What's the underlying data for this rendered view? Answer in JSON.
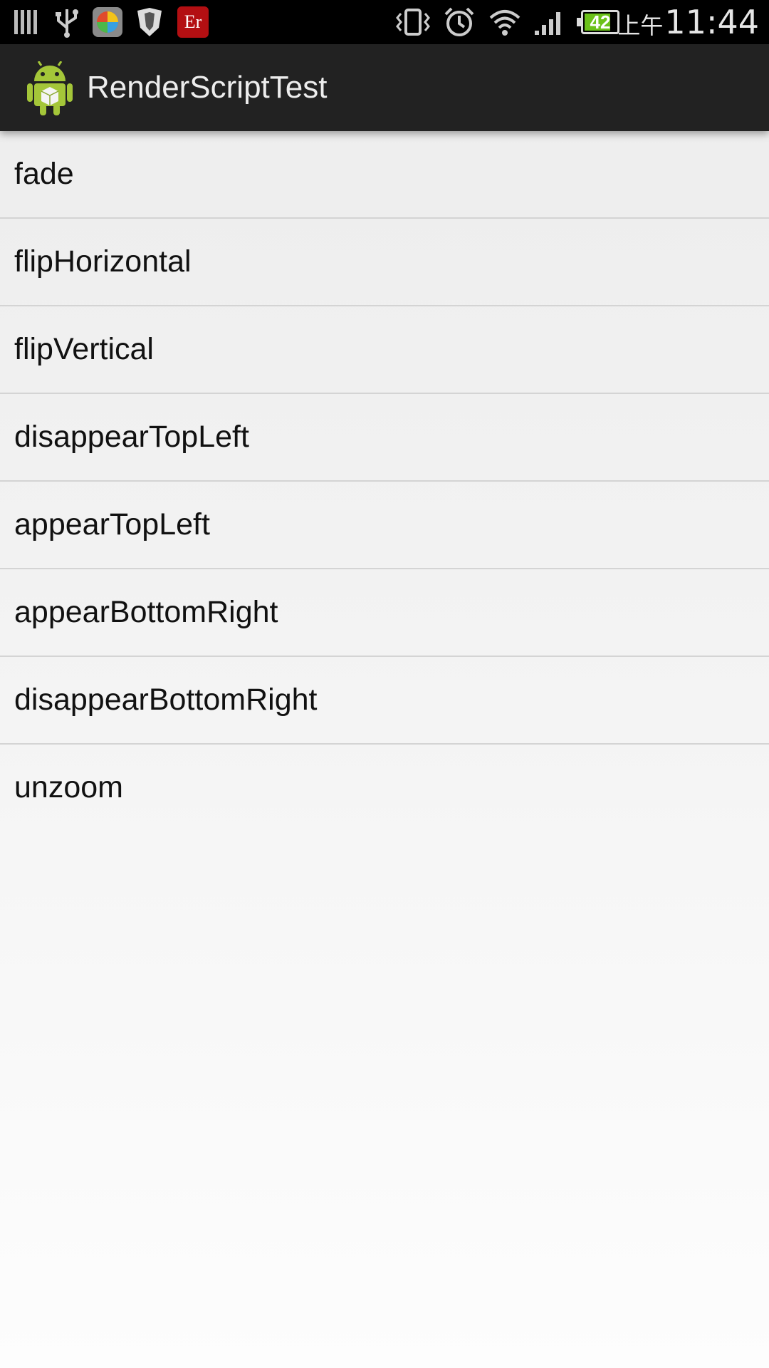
{
  "status_bar": {
    "icons": [
      "signal-bars-notification-icon",
      "usb-icon",
      "color-ball-app-icon",
      "shield-icon",
      "er-app-icon",
      "vibrate-icon",
      "alarm-icon",
      "wifi-icon",
      "cell-signal-icon",
      "battery-icon"
    ],
    "er_label": "Er",
    "battery_level": "42",
    "time_prefix": "上午",
    "time": "11:44"
  },
  "action_bar": {
    "title": "RenderScriptTest",
    "background": "#222222"
  },
  "list": {
    "items": [
      {
        "label": "fade"
      },
      {
        "label": "flipHorizontal"
      },
      {
        "label": "flipVertical"
      },
      {
        "label": "disappearTopLeft"
      },
      {
        "label": "appearTopLeft"
      },
      {
        "label": "appearBottomRight"
      },
      {
        "label": "disappearBottomRight"
      },
      {
        "label": "unzoom"
      }
    ]
  }
}
